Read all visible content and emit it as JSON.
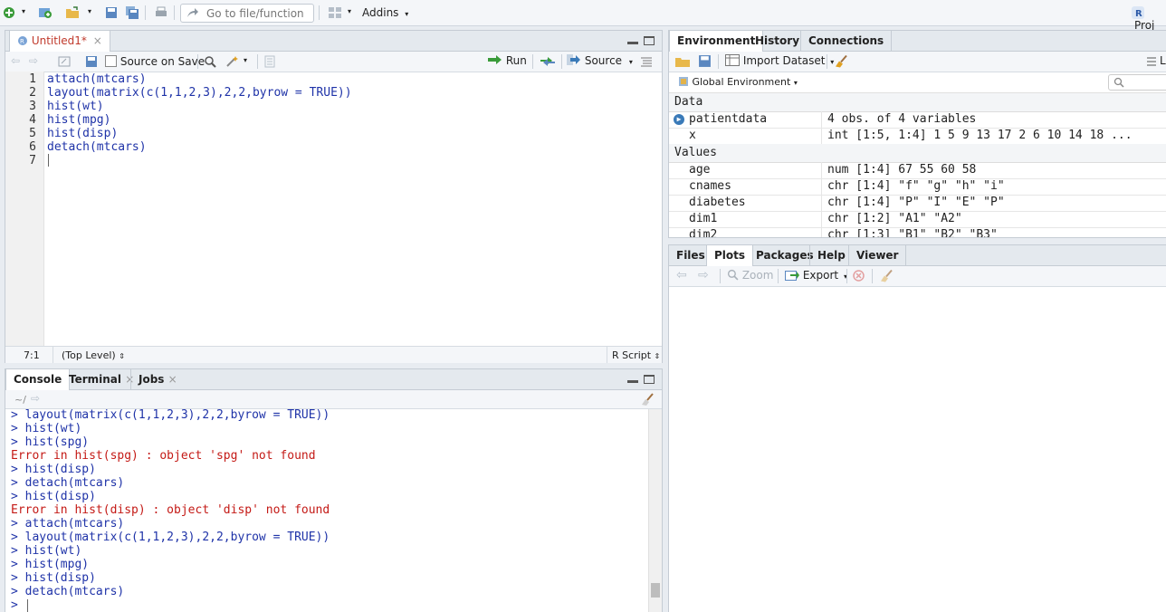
{
  "toolbar": {
    "goto_placeholder": "Go to file/function",
    "addins_label": "Addins",
    "project_label": "Proj"
  },
  "editor": {
    "tab_label": "Untitled1*",
    "source_on_save_label": "Source on Save",
    "run_label": "Run",
    "source_label": "Source",
    "lines": [
      {
        "n": "1",
        "text": "attach(mtcars)"
      },
      {
        "n": "2",
        "text": "layout(matrix(c(1,1,2,3),2,2,byrow = TRUE))"
      },
      {
        "n": "3",
        "text": "hist(wt)"
      },
      {
        "n": "4",
        "text": "hist(mpg)"
      },
      {
        "n": "5",
        "text": "hist(disp)"
      },
      {
        "n": "6",
        "text": "detach(mtcars)"
      },
      {
        "n": "7",
        "text": ""
      }
    ],
    "status_position": "7:1",
    "status_scope": "(Top Level)",
    "status_lang": "R Script"
  },
  "console": {
    "tabs": [
      "Console",
      "Terminal",
      "Jobs"
    ],
    "path": "~/",
    "lines": [
      {
        "type": "in",
        "text": "> layout(matrix(c(1,1,2,3),2,2,byrow = TRUE))"
      },
      {
        "type": "in",
        "text": "> hist(wt)"
      },
      {
        "type": "in",
        "text": "> hist(spg)"
      },
      {
        "type": "err",
        "text": "Error in hist(spg) : object 'spg' not found"
      },
      {
        "type": "in",
        "text": "> hist(disp)"
      },
      {
        "type": "in",
        "text": "> detach(mtcars)"
      },
      {
        "type": "in",
        "text": "> hist(disp)"
      },
      {
        "type": "err",
        "text": "Error in hist(disp) : object 'disp' not found"
      },
      {
        "type": "in",
        "text": "> attach(mtcars)"
      },
      {
        "type": "in",
        "text": "> layout(matrix(c(1,1,2,3),2,2,byrow = TRUE))"
      },
      {
        "type": "in",
        "text": "> hist(wt)"
      },
      {
        "type": "in",
        "text": "> hist(mpg)"
      },
      {
        "type": "in",
        "text": "> hist(disp)"
      },
      {
        "type": "in",
        "text": "> detach(mtcars)"
      },
      {
        "type": "in",
        "text": "> "
      }
    ]
  },
  "environment": {
    "tabs": [
      "Environment",
      "History",
      "Connections"
    ],
    "import_label": "Import Dataset",
    "global_env_label": "Global Environment",
    "list_label": "L",
    "data_header": "Data",
    "values_header": "Values",
    "data_rows": [
      {
        "name": "patientdata",
        "value": "4 obs. of 4 variables"
      },
      {
        "name": "x",
        "value": "int [1:5, 1:4] 1 5 9 13 17 2 6 10 14 18 ..."
      }
    ],
    "value_rows": [
      {
        "name": "age",
        "value": "num [1:4] 67 55 60 58"
      },
      {
        "name": "cnames",
        "value": "chr [1:4] \"f\" \"g\" \"h\" \"i\""
      },
      {
        "name": "diabetes",
        "value": "chr [1:4] \"P\" \"I\" \"E\" \"P\""
      },
      {
        "name": "dim1",
        "value": "chr [1:2] \"A1\" \"A2\""
      },
      {
        "name": "dim2",
        "value": "chr [1:3] \"B1\" \"B2\" \"B3\""
      }
    ]
  },
  "files": {
    "tabs": [
      "Files",
      "Plots",
      "Packages",
      "Help",
      "Viewer"
    ],
    "zoom_label": "Zoom",
    "export_label": "Export"
  }
}
